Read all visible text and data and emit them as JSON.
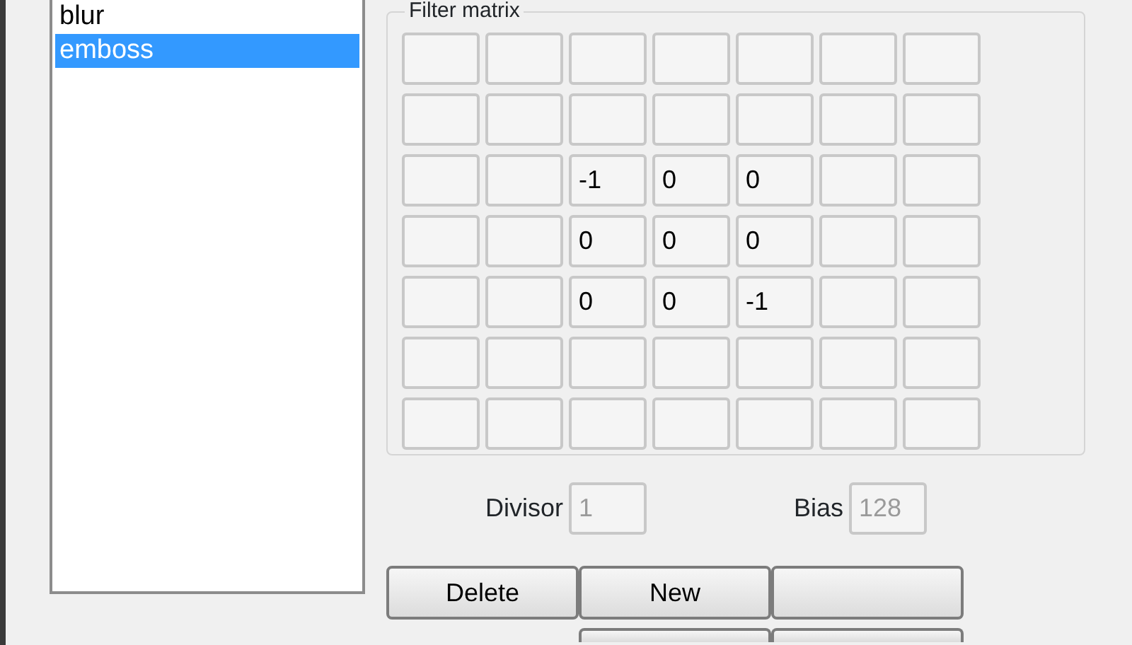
{
  "filters": [
    {
      "label": "blur",
      "selected": false
    },
    {
      "label": "emboss",
      "selected": true
    }
  ],
  "filter_matrix": {
    "title": "Filter matrix",
    "rows": [
      [
        null,
        null,
        null,
        null,
        null,
        null,
        null
      ],
      [
        null,
        null,
        null,
        null,
        null,
        null,
        null
      ],
      [
        null,
        null,
        "-1",
        "0",
        "0",
        null,
        null
      ],
      [
        null,
        null,
        "0",
        "0",
        "0",
        null,
        null
      ],
      [
        null,
        null,
        "0",
        "0",
        "-1",
        null,
        null
      ],
      [
        null,
        null,
        null,
        null,
        null,
        null,
        null
      ],
      [
        null,
        null,
        null,
        null,
        null,
        null,
        null
      ]
    ]
  },
  "divisor": {
    "label": "Divisor",
    "value": "1",
    "disabled": true
  },
  "bias": {
    "label": "Bias",
    "value": "128",
    "disabled": true
  },
  "buttons": [
    {
      "kind": "delete",
      "label": "Delete"
    },
    {
      "kind": "new",
      "label": "New"
    },
    {
      "kind": "save"
    },
    {
      "kind": "edit"
    },
    {
      "kind": "apply"
    }
  ]
}
